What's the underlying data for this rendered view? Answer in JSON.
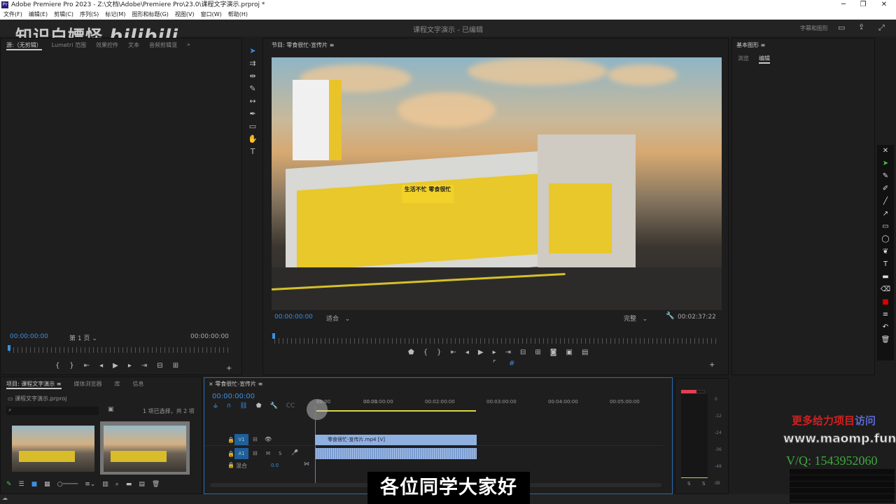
{
  "app": {
    "title": "Adobe Premiere Pro 2023 - Z:\\文档\\Adobe\\Premiere Pro\\23.0\\课程文字演示.prproj *",
    "logo": "Pr",
    "window_controls": [
      "minimize",
      "restore",
      "close"
    ]
  },
  "menu": [
    "文件(F)",
    "编辑(E)",
    "剪辑(C)",
    "序列(S)",
    "标记(M)",
    "图形和标题(G)",
    "视图(V)",
    "窗口(W)",
    "帮助(H)"
  ],
  "workspace": {
    "doc_title": "课程文字演示 - 已编辑",
    "captions_label": "字幕和图形"
  },
  "watermark": {
    "text": "知识白嫖怪",
    "brand": "bilibili"
  },
  "source_panel": {
    "tabs": [
      "源:（无剪辑）",
      "Lumetri 范围",
      "效果控件",
      "文本",
      "音频剪辑混"
    ],
    "timecode_in": "00:00:00:00",
    "page": "第 1 页",
    "timecode_out": "00:00:00:00"
  },
  "program_monitor": {
    "title": "节目: 零食很忙-宣传片",
    "timecode": "00:00:00:00",
    "fit": "适合",
    "quality": "完整",
    "duration": "00:02:37:22",
    "video_signage": "生活不忙 零食很忙"
  },
  "right_panel": {
    "title": "基本图形",
    "tabs": [
      "浏览",
      "编辑"
    ],
    "active_tab": "编辑"
  },
  "project_panel": {
    "tabs": [
      "项目: 课程文字演示",
      "媒体浏览器",
      "库",
      "信息"
    ],
    "project_file": "课程文字演示.prproj",
    "selection": "1 项已选择，共 2 项",
    "search_placeholder": ""
  },
  "timeline": {
    "sequence": "零食很忙-宣传片",
    "timecode": "00:00:00:00",
    "ruler": [
      "00:00",
      "00:01:00:00",
      "00:02:00:00",
      "00:03:00:00",
      "00:04:00:00",
      "00:05:00:00"
    ],
    "tracks": {
      "v1": "V1",
      "a1": "A1",
      "m": "M",
      "s": "S",
      "mix": "混合",
      "mix_value": "0.0"
    },
    "video_clip": "零食很忙-宣传片.mp4 [V]"
  },
  "audio_meter": {
    "scale": [
      "0",
      "-12",
      "-24",
      "-36",
      "-48",
      "dB"
    ],
    "buttons": [
      "S",
      "S"
    ]
  },
  "subtitle": "各位同学大家好",
  "ad": {
    "line1": "更多给力项目",
    "line1b": "访问",
    "url": "www.maomp.fun",
    "contact": "V/Q: 1543952060"
  },
  "colors": {
    "accent": "#3b8fe0",
    "clip": "#8fb0e0",
    "meter_peak": "#e04050"
  }
}
